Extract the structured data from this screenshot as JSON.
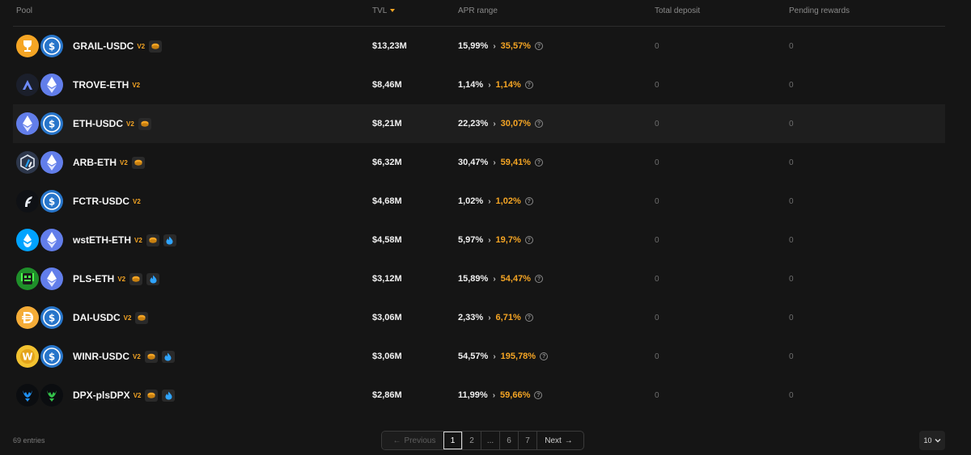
{
  "table": {
    "headers": {
      "pool": "Pool",
      "tvl": "TVL",
      "apr": "APR range",
      "deposit": "Total deposit",
      "pending": "Pending rewards"
    },
    "rows": [
      {
        "name": "GRAIL-USDC",
        "v2": "V2",
        "tvl": "$13,23M",
        "apr_min": "15,99%",
        "apr_max": "35,57%",
        "deposit": "0",
        "pending": "0"
      },
      {
        "name": "TROVE-ETH",
        "v2": "V2",
        "tvl": "$8,46M",
        "apr_min": "1,14%",
        "apr_max": "1,14%",
        "deposit": "0",
        "pending": "0"
      },
      {
        "name": "ETH-USDC",
        "v2": "V2",
        "tvl": "$8,21M",
        "apr_min": "22,23%",
        "apr_max": "30,07%",
        "deposit": "0",
        "pending": "0"
      },
      {
        "name": "ARB-ETH",
        "v2": "V2",
        "tvl": "$6,32M",
        "apr_min": "30,47%",
        "apr_max": "59,41%",
        "deposit": "0",
        "pending": "0"
      },
      {
        "name": "FCTR-USDC",
        "v2": "V2",
        "tvl": "$4,68M",
        "apr_min": "1,02%",
        "apr_max": "1,02%",
        "deposit": "0",
        "pending": "0"
      },
      {
        "name": "wstETH-ETH",
        "v2": "V2",
        "tvl": "$4,58M",
        "apr_min": "5,97%",
        "apr_max": "19,7%",
        "deposit": "0",
        "pending": "0"
      },
      {
        "name": "PLS-ETH",
        "v2": "V2",
        "tvl": "$3,12M",
        "apr_min": "15,89%",
        "apr_max": "54,47%",
        "deposit": "0",
        "pending": "0"
      },
      {
        "name": "DAI-USDC",
        "v2": "V2",
        "tvl": "$3,06M",
        "apr_min": "2,33%",
        "apr_max": "6,71%",
        "deposit": "0",
        "pending": "0"
      },
      {
        "name": "WINR-USDC",
        "v2": "V2",
        "tvl": "$3,06M",
        "apr_min": "54,57%",
        "apr_max": "195,78%",
        "deposit": "0",
        "pending": "0"
      },
      {
        "name": "DPX-plsDPX",
        "v2": "V2",
        "tvl": "$2,86M",
        "apr_min": "11,99%",
        "apr_max": "59,66%",
        "deposit": "0",
        "pending": "0"
      }
    ]
  },
  "footer": {
    "entries": "69 entries",
    "previous": "Previous",
    "pages": [
      "1",
      "2",
      "...",
      "6",
      "7"
    ],
    "next": "Next",
    "per_page": "10"
  },
  "colors": {
    "accent": "#f5a524",
    "background": "#151515",
    "highlight_row": "#1e1e1e"
  }
}
